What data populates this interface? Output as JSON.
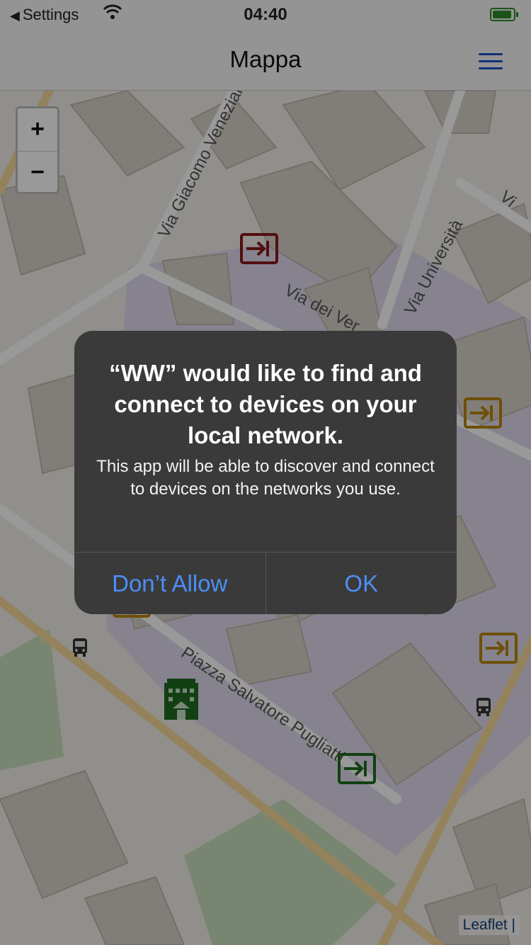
{
  "status_bar": {
    "back_label": "Settings",
    "time": "04:40",
    "battery_color": "#2e8b2e"
  },
  "nav": {
    "title": "Mappa",
    "menu_icon": "hamburger-menu-icon"
  },
  "map": {
    "zoom_in": "+",
    "zoom_out": "−",
    "attribution": "Leaflet |",
    "streets": {
      "giacomo_venezian": "Via Giacomo Venezian",
      "universita": "Via Università",
      "dei_ver": "Via dei Ver",
      "vi": "Vi",
      "pugliatti": "Piazza Salvatore Pugliatti"
    },
    "markers": {
      "entrance_red_color": "#8b1a1a",
      "entrance_gold_color": "#b8860b",
      "entrance_green_color": "#1e6b1e",
      "building_color": "#1e6b1e",
      "bus_color": "#333333"
    }
  },
  "alert": {
    "title": "“WW” would like to find and connect to devices on your local network.",
    "message": "This app will be able to discover and connect to devices on the networks you use.",
    "deny_label": "Don’t Allow",
    "ok_label": "OK",
    "button_color": "#4c8ff5"
  }
}
